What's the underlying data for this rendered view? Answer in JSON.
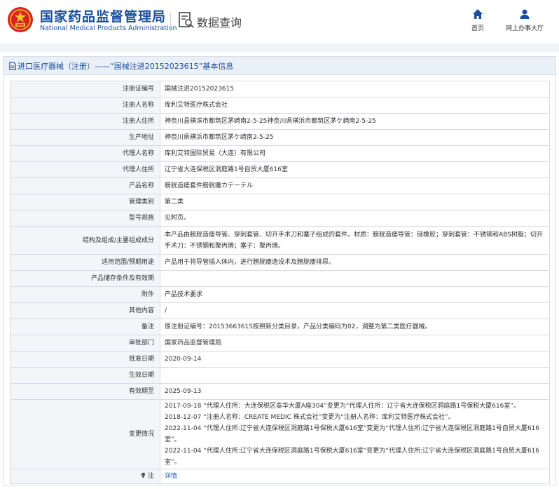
{
  "header": {
    "brand_cn": "国家药品监督管理局",
    "brand_en": "National Medical Products Administration",
    "section": "数据查询",
    "nav": [
      {
        "label": "首页",
        "icon": "home-icon"
      },
      {
        "label": "网上办事大厅",
        "icon": "user-icon"
      }
    ]
  },
  "panel": {
    "title": "进口医疗器械（注册）——“国械注进20152023615”基本信息"
  },
  "fields": [
    {
      "label": "注册证编号",
      "value": "国械注进20152023615"
    },
    {
      "label": "注册人名称",
      "value": "库利艾特医疗株式会社"
    },
    {
      "label": "注册人住所",
      "value": "神奈川县横滨市都筑区茅崎南2-5-25神奈川県横浜市都筑区茅ケ崎南2-5-25"
    },
    {
      "label": "生产地址",
      "value": "神奈川県横浜市都筑区茅ケ崎南2-5-25"
    },
    {
      "label": "代理人名称",
      "value": "库利艾特国际贸易（大连）有限公司"
    },
    {
      "label": "代理人住所",
      "value": "辽宁省大连保税区洞庭路1号自贸大厦616室"
    },
    {
      "label": "产品名称",
      "value": "膀胱造瘘套件膀胱瘻カテーテル"
    },
    {
      "label": "管理类别",
      "value": "第二类"
    },
    {
      "label": "型号规格",
      "value": "见附页。"
    },
    {
      "label": "结构及组成/主要组成成分",
      "value": "本产品由膀胱造瘘导管、穿刺套管、切开手术刀和塞子组成的套件。材质：膀胱造瘘导管：硅橡胶；穿刺套管：不锈钢和ABS树脂；切开手术刀：不锈钢和聚丙烯；塞子：聚丙烯。"
    },
    {
      "label": "适用范围/预期用途",
      "value": "产品用于将导管插入体内，进行膀胱瘘造设术及膀胱瘘排尿。"
    },
    {
      "label": "产品储存条件及有效期",
      "value": ""
    },
    {
      "label": "附件",
      "value": "产品技术要求"
    },
    {
      "label": "其他内容",
      "value": "/"
    },
    {
      "label": "备注",
      "value": "原注册证编号：20153663615按照新分类目录，产品分类编码为02，调整为第二类医疗器械。"
    },
    {
      "label": "审批部门",
      "value": "国家药品监督管理局"
    },
    {
      "label": "批准日期",
      "value": "2020-09-14"
    },
    {
      "label": "生效日期",
      "value": ""
    },
    {
      "label": "有效期至",
      "value": "2025-09-13"
    }
  ],
  "history": {
    "label": "变更情况",
    "items": [
      "2017-09-18 “代理人住所：大连保税区泰华大厦A座304”变更为“代理人住所：辽宁省大连保税区洞庭路1号保税大厦616室”。",
      "2018-12-07 “注册人名称：CREATE MEDIC 株式会社”变更为“注册人名称：库利艾特医疗株式会社”。",
      "2022-11-04 “代理人住所:辽宁省大连保税区洞庭路1号保税大厦616室”变更为“代理人住所:辽宁省大连保税区洞庭路1号自贸大厦616室”。",
      "2022-11-04 “代理人住所:辽宁省大连保税区洞庭路1号保税大厦616室”变更为“代理人住所:辽宁省大连保税区洞庭路1号自贸大厦616室”。"
    ]
  },
  "notes": {
    "label": "注",
    "link": "详情"
  },
  "colors": {
    "brand": "#1a4f9c",
    "link": "#1a55b0",
    "label_bg": "#f3f5f8",
    "title_bg": "#eaf0f8"
  }
}
